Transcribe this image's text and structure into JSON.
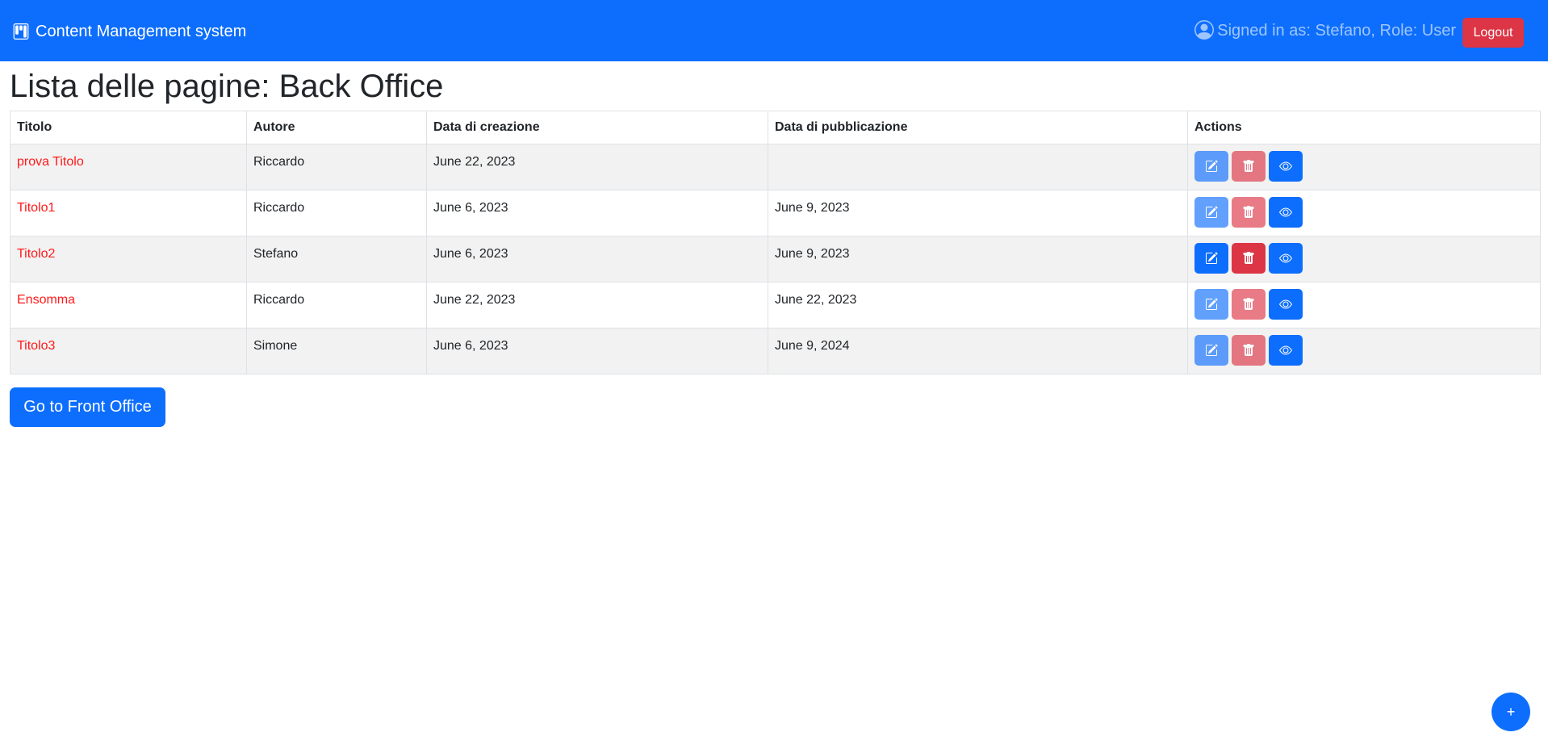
{
  "navbar": {
    "brand_icon": "kanban-icon",
    "brand": "Content Management system",
    "user_icon": "person-circle-icon",
    "signed_in": "Signed in as: Stefano, Role: User",
    "logout_label": "Logout"
  },
  "page_title": "Lista delle pagine: Back Office",
  "table": {
    "headers": [
      "Titolo",
      "Autore",
      "Data di creazione",
      "Data di pubblicazione",
      "Actions"
    ],
    "rows": [
      {
        "title": "prova Titolo",
        "author": "Riccardo",
        "created": "June 22, 2023",
        "published": "",
        "actions_enabled": false
      },
      {
        "title": "Titolo1",
        "author": "Riccardo",
        "created": "June 6, 2023",
        "published": "June 9, 2023",
        "actions_enabled": false
      },
      {
        "title": "Titolo2",
        "author": "Stefano",
        "created": "June 6, 2023",
        "published": "June 9, 2023",
        "actions_enabled": true
      },
      {
        "title": "Ensomma",
        "author": "Riccardo",
        "created": "June 22, 2023",
        "published": "June 22, 2023",
        "actions_enabled": false
      },
      {
        "title": "Titolo3",
        "author": "Simone",
        "created": "June 6, 2023",
        "published": "June 9, 2024",
        "actions_enabled": false
      }
    ],
    "action_icons": [
      "pencil-square-icon",
      "trash-icon",
      "eye-icon"
    ]
  },
  "front_office_button": "Go to Front Office",
  "fab_label": "+",
  "colors": {
    "primary": "#0d6efd",
    "danger": "#dc3545",
    "title_link": "#ff1a1a",
    "stripe": "#f2f2f2"
  }
}
